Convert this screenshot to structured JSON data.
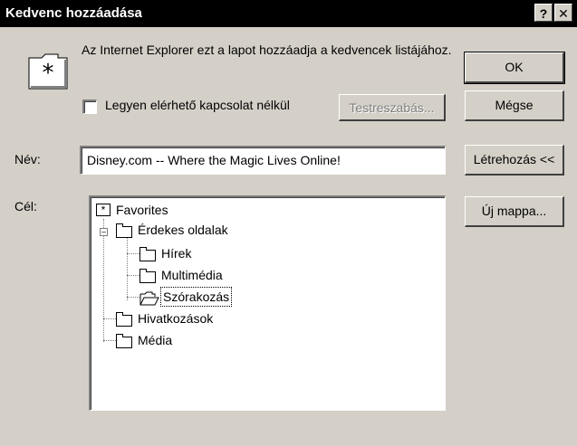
{
  "window": {
    "title": "Kedvenc hozzáadása",
    "help_label": "?",
    "close_label": "✕"
  },
  "info": {
    "message": "Az Internet Explorer ezt a lapot hozzáadja a kedvencek listájához.",
    "offline_label": "Legyen elérhető kapcsolat nélkül",
    "offline_checked": false
  },
  "buttons": {
    "ok": "OK",
    "cancel": "Mégse",
    "customize": "Testreszabás...",
    "create_in": "Létrehozás <<",
    "new_folder": "Új mappa..."
  },
  "name_field": {
    "label": "Név:",
    "value": "Disney.com -- Where the Magic Lives Online!"
  },
  "target": {
    "label": "Cél:",
    "tree": [
      {
        "label": "Favorites",
        "icon": "favorites-star-icon",
        "level": 0
      },
      {
        "label": "Érdekes oldalak",
        "icon": "folder-icon",
        "level": 1,
        "expanded": true
      },
      {
        "label": "Hírek",
        "icon": "folder-icon",
        "level": 2
      },
      {
        "label": "Multimédia",
        "icon": "folder-icon",
        "level": 2
      },
      {
        "label": "Szórakozás",
        "icon": "open-folder-icon",
        "level": 2,
        "selected": true
      },
      {
        "label": "Hivatkozások",
        "icon": "folder-icon",
        "level": 1
      },
      {
        "label": "Média",
        "icon": "folder-icon",
        "level": 1
      }
    ]
  }
}
